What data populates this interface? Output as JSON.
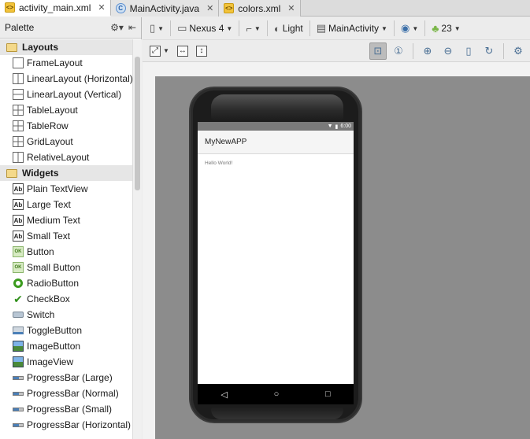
{
  "tabs": [
    {
      "label": "activity_main.xml",
      "icon": "xml-file-icon",
      "active": true
    },
    {
      "label": "MainActivity.java",
      "icon": "java-class-icon",
      "active": false
    },
    {
      "label": "colors.xml",
      "icon": "xml-file-icon",
      "active": false
    }
  ],
  "palette": {
    "title": "Palette",
    "groups": [
      {
        "label": "Layouts",
        "items": [
          "FrameLayout",
          "LinearLayout (Horizontal)",
          "LinearLayout (Vertical)",
          "TableLayout",
          "TableRow",
          "GridLayout",
          "RelativeLayout"
        ]
      },
      {
        "label": "Widgets",
        "items": [
          "Plain TextView",
          "Large Text",
          "Medium Text",
          "Small Text",
          "Button",
          "Small Button",
          "RadioButton",
          "CheckBox",
          "Switch",
          "ToggleButton",
          "ImageButton",
          "ImageView",
          "ProgressBar (Large)",
          "ProgressBar (Normal)",
          "ProgressBar (Small)",
          "ProgressBar (Horizontal)"
        ]
      }
    ]
  },
  "toolbar": {
    "device": "Nexus 4",
    "theme": "Light",
    "activity": "MainActivity",
    "api": "23"
  },
  "preview": {
    "status_time": "6:00",
    "app_title": "MyNewAPP",
    "content_text": "Hello World!"
  }
}
